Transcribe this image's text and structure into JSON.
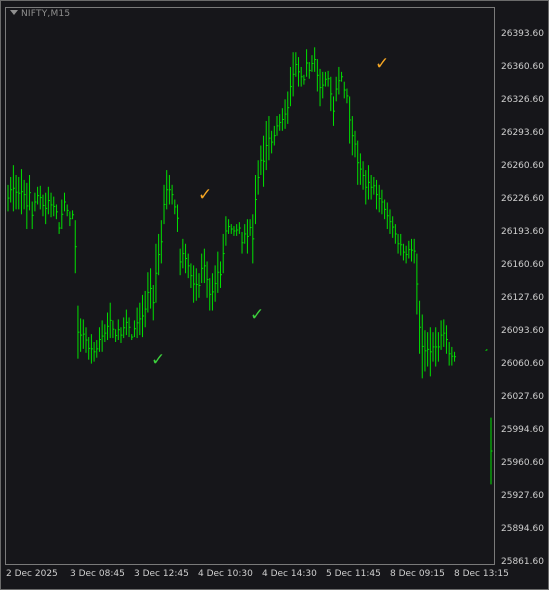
{
  "symbol": {
    "label": "NIFTY,M15",
    "menu_icon": "triangle-down-icon"
  },
  "colors": {
    "background": "#16161a",
    "bars": "#00e000",
    "axis_text": "#cfcfcf",
    "check_orange": "#f5a623",
    "check_green": "#3ccf3c",
    "gridline": "#7a7a7a"
  },
  "chart_data": {
    "type": "ohlc",
    "title": "",
    "ylim": [
      25844.0,
      26410.0
    ],
    "y_ticks": [
      "26393.60",
      "26360.60",
      "26326.60",
      "26293.60",
      "26260.60",
      "26226.60",
      "26193.60",
      "26160.60",
      "26127.60",
      "26093.60",
      "26060.60",
      "26027.60",
      "25994.60",
      "25960.60",
      "25927.60",
      "25894.60",
      "25861.60"
    ],
    "x_ticks": [
      "2 Dec 2025",
      "3 Dec 08:45",
      "3 Dec 12:45",
      "4 Dec 10:30",
      "4 Dec 14:30",
      "5 Dec 11:45",
      "8 Dec 09:15",
      "8 Dec 13:15"
    ],
    "grid": false,
    "bars": [
      [
        26230,
        26203
      ],
      [
        26238,
        26212
      ],
      [
        26250,
        26203
      ],
      [
        26240,
        26205
      ],
      [
        26238,
        26205
      ],
      [
        26246,
        26200
      ],
      [
        26235,
        26205
      ],
      [
        26232,
        26185
      ],
      [
        26240,
        26204
      ],
      [
        26213,
        26185
      ],
      [
        26222,
        26203
      ],
      [
        26228,
        26210
      ],
      [
        26229,
        26205
      ],
      [
        26220,
        26198
      ],
      [
        26222,
        26190
      ],
      [
        26228,
        26200
      ],
      [
        26222,
        26197
      ],
      [
        26218,
        26198
      ],
      [
        26210,
        26195
      ],
      [
        26192,
        26180
      ],
      [
        26215,
        26185
      ],
      [
        26222,
        26203
      ],
      [
        26210,
        26198
      ],
      [
        26203,
        26188
      ],
      [
        26204,
        26195
      ],
      [
        26194,
        26140
      ],
      [
        26107,
        26053
      ],
      [
        26094,
        26060
      ],
      [
        26093,
        26063
      ],
      [
        26085,
        26059
      ],
      [
        26075,
        26052
      ],
      [
        26078,
        26048
      ],
      [
        26070,
        26050
      ],
      [
        26072,
        26054
      ],
      [
        26085,
        26060
      ],
      [
        26092,
        26060
      ],
      [
        26088,
        26070
      ],
      [
        26100,
        26072
      ],
      [
        26110,
        26074
      ],
      [
        26092,
        26074
      ],
      [
        26083,
        26070
      ],
      [
        26093,
        26072
      ],
      [
        26085,
        26069
      ],
      [
        26095,
        26074
      ],
      [
        26103,
        26077
      ],
      [
        26095,
        26075
      ],
      [
        26078,
        26072
      ],
      [
        26092,
        26075
      ],
      [
        26105,
        26074
      ],
      [
        26110,
        26077
      ],
      [
        26118,
        26075
      ],
      [
        26122,
        26085
      ],
      [
        26141,
        26100
      ],
      [
        26145,
        26104
      ],
      [
        26128,
        26092
      ],
      [
        26170,
        26110
      ],
      [
        26180,
        26138
      ],
      [
        26194,
        26150
      ],
      [
        26230,
        26190
      ],
      [
        26245,
        26205
      ],
      [
        26240,
        26210
      ],
      [
        26230,
        26210
      ],
      [
        26215,
        26200
      ],
      [
        26210,
        26182
      ],
      [
        26165,
        26138
      ],
      [
        26175,
        26145
      ],
      [
        26170,
        26140
      ],
      [
        26160,
        26135
      ],
      [
        26150,
        26125
      ],
      [
        26148,
        26110
      ],
      [
        26145,
        26112
      ],
      [
        26140,
        26115
      ],
      [
        26160,
        26130
      ],
      [
        26165,
        26130
      ],
      [
        26152,
        26115
      ],
      [
        26135,
        26102
      ],
      [
        26140,
        26102
      ],
      [
        26148,
        26111
      ],
      [
        26162,
        26120
      ],
      [
        26152,
        26125
      ],
      [
        26180,
        26140
      ],
      [
        26198,
        26168
      ],
      [
        26195,
        26180
      ],
      [
        26190,
        26180
      ],
      [
        26188,
        26178
      ],
      [
        26190,
        26178
      ],
      [
        26192,
        26180
      ],
      [
        26182,
        26160
      ],
      [
        26190,
        26170
      ],
      [
        26195,
        26160
      ],
      [
        26195,
        26178
      ],
      [
        26200,
        26150
      ],
      [
        26240,
        26190
      ],
      [
        26255,
        26220
      ],
      [
        26270,
        26240
      ],
      [
        26280,
        26228
      ],
      [
        26295,
        26245
      ],
      [
        26300,
        26255
      ],
      [
        26285,
        26262
      ],
      [
        26290,
        26270
      ],
      [
        26300,
        26280
      ],
      [
        26302,
        26285
      ],
      [
        26308,
        26285
      ],
      [
        26317,
        26287
      ],
      [
        26325,
        26292
      ],
      [
        26350,
        26310
      ],
      [
        26365,
        26320
      ],
      [
        26365,
        26340
      ],
      [
        26360,
        26330
      ],
      [
        26350,
        26330
      ],
      [
        26342,
        26332
      ],
      [
        26368,
        26340
      ],
      [
        26355,
        26338
      ],
      [
        26362,
        26345
      ],
      [
        26370,
        26345
      ],
      [
        26358,
        26325
      ],
      [
        26348,
        26310
      ],
      [
        26345,
        26318
      ],
      [
        26345,
        26330
      ],
      [
        26346,
        26330
      ],
      [
        26340,
        26305
      ],
      [
        26320,
        26290
      ],
      [
        26340,
        26315
      ],
      [
        26350,
        26322
      ],
      [
        26345,
        26335
      ],
      [
        26335,
        26318
      ],
      [
        26328,
        26313
      ],
      [
        26320,
        26272
      ],
      [
        26300,
        26260
      ],
      [
        26285,
        26258
      ],
      [
        26275,
        26230
      ],
      [
        26262,
        26230
      ],
      [
        26254,
        26225
      ],
      [
        26245,
        26210
      ],
      [
        26250,
        26215
      ],
      [
        26240,
        26215
      ],
      [
        26238,
        26220
      ],
      [
        26235,
        26205
      ],
      [
        26230,
        26202
      ],
      [
        26225,
        26200
      ],
      [
        26215,
        26195
      ],
      [
        26212,
        26185
      ],
      [
        26205,
        26180
      ],
      [
        26198,
        26176
      ],
      [
        26190,
        26170
      ],
      [
        26180,
        26160
      ],
      [
        26180,
        26158
      ],
      [
        26170,
        26153
      ],
      [
        26168,
        26150
      ],
      [
        26173,
        26155
      ],
      [
        26175,
        26152
      ],
      [
        26175,
        26150
      ],
      [
        26160,
        26098
      ],
      [
        26112,
        26058
      ],
      [
        26098,
        26033
      ],
      [
        26082,
        26040
      ],
      [
        26080,
        26045
      ],
      [
        26085,
        26035
      ],
      [
        26080,
        26050
      ],
      [
        26085,
        26045
      ],
      [
        26080,
        26050
      ],
      [
        26092,
        26062
      ],
      [
        26093,
        26065
      ],
      [
        26087,
        26058
      ],
      [
        26070,
        26046
      ],
      [
        26065,
        26046
      ],
      [
        26060,
        26050
      ]
    ],
    "tail_bars": [
      [
        26062,
        26062
      ],
      [
        25993,
        25925
      ]
    ]
  },
  "annotations": [
    {
      "icon": "check-orange-icon",
      "glyph": "✓",
      "color": "#f5a623"
    },
    {
      "icon": "check-green-icon",
      "glyph": "✓",
      "color": "#3ccf3c"
    },
    {
      "icon": "check-orange-icon",
      "glyph": "✓",
      "color": "#f5a623"
    },
    {
      "icon": "check-green-icon",
      "glyph": "✓",
      "color": "#3ccf3c"
    }
  ]
}
